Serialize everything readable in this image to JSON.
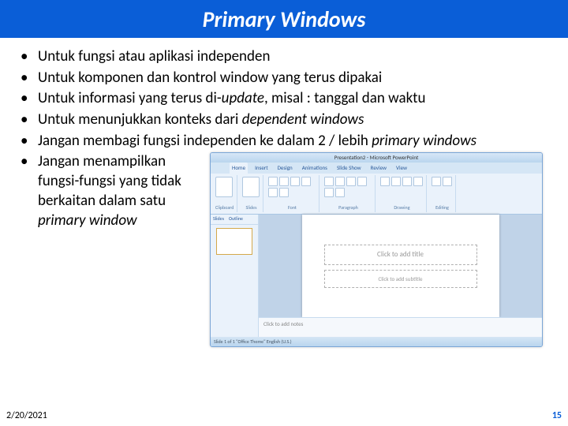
{
  "title": "Primary Windows",
  "bullets": {
    "b1": "Untuk fungsi atau aplikasi independen",
    "b2": "Untuk komponen dan kontrol window yang terus dipakai",
    "b3_a": "Untuk informasi yang terus di-",
    "b3_b": "update",
    "b3_c": ", misal : tanggal dan waktu",
    "b4_a": "Untuk menunjukkan konteks dari ",
    "b4_b": "dependent windows",
    "b5_a": "Jangan membagi fungsi independen ke dalam 2 / lebih ",
    "b5_b": "primary windows",
    "b6_a": "Jangan menampilkan fungsi-fungsi yang tidak berkaitan dalam satu ",
    "b6_b": "primary window"
  },
  "ppt": {
    "titlebar": "Presentation2 - Microsoft PowerPoint",
    "tabs": {
      "home": "Home",
      "insert": "Insert",
      "design": "Design",
      "animations": "Animations",
      "slideshow": "Slide Show",
      "review": "Review",
      "view": "View"
    },
    "groups": {
      "clipboard": "Clipboard",
      "slides": "Slides",
      "font": "Font",
      "paragraph": "Paragraph",
      "drawing": "Drawing",
      "editing": "Editing"
    },
    "sidebar": {
      "slides": "Slides",
      "outline": "Outline"
    },
    "placeholders": {
      "title": "Click to add title",
      "subtitle": "Click to add subtitle"
    },
    "notes": "Click to add notes",
    "status": "Slide 1 of 1  \"Office Theme\"  English (U.S.)"
  },
  "footer": {
    "date": "2/20/2021",
    "page": "15"
  }
}
